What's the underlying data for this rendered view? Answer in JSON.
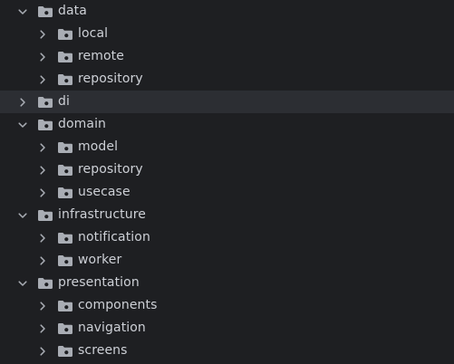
{
  "tree": {
    "items": [
      {
        "label": "data",
        "level": 0,
        "expanded": true
      },
      {
        "label": "local",
        "level": 1,
        "expanded": false
      },
      {
        "label": "remote",
        "level": 1,
        "expanded": false
      },
      {
        "label": "repository",
        "level": 1,
        "expanded": false
      },
      {
        "label": "di",
        "level": 0,
        "expanded": false,
        "selected": true
      },
      {
        "label": "domain",
        "level": 0,
        "expanded": true
      },
      {
        "label": "model",
        "level": 1,
        "expanded": false
      },
      {
        "label": "repository",
        "level": 1,
        "expanded": false
      },
      {
        "label": "usecase",
        "level": 1,
        "expanded": false
      },
      {
        "label": "infrastructure",
        "level": 0,
        "expanded": true
      },
      {
        "label": "notification",
        "level": 1,
        "expanded": false
      },
      {
        "label": "worker",
        "level": 1,
        "expanded": false
      },
      {
        "label": "presentation",
        "level": 0,
        "expanded": true
      },
      {
        "label": "components",
        "level": 1,
        "expanded": false
      },
      {
        "label": "navigation",
        "level": 1,
        "expanded": false
      },
      {
        "label": "screens",
        "level": 1,
        "expanded": false
      }
    ]
  },
  "colors": {
    "background": "#1e1f22",
    "selected_row": "#2c2e33",
    "text": "#cdd0d6",
    "icon": "#a9adb4"
  },
  "icons": {
    "expanded": "chevron-down-icon",
    "collapsed": "chevron-right-icon",
    "folder": "package-folder-icon"
  }
}
